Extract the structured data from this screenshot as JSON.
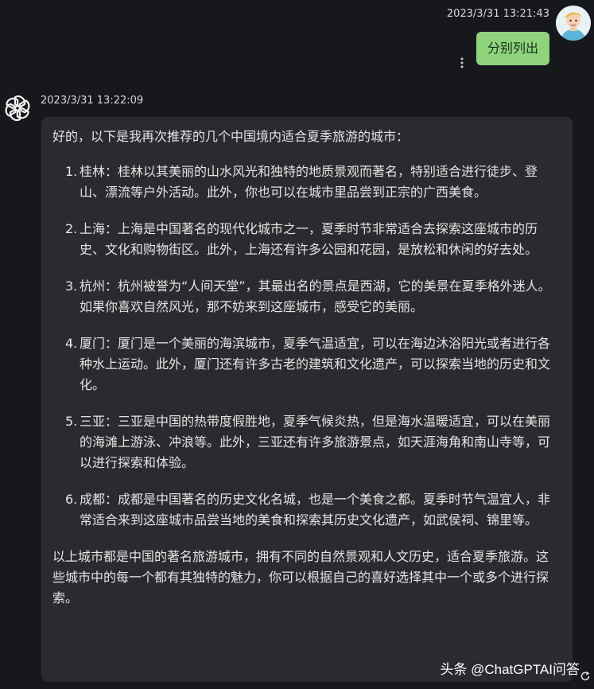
{
  "user_message": {
    "timestamp": "2023/3/31 13:21:43",
    "text": "分别列出",
    "avatar_icon": "user-avatar-icon",
    "more_icon": "more-vertical-icon"
  },
  "bot_message": {
    "timestamp": "2023/3/31 13:22:09",
    "avatar_icon": "openai-logo-icon",
    "intro": "好的，以下是我再次推荐的几个中国境内适合夏季旅游的城市：",
    "items": [
      {
        "num": "1.",
        "text": "桂林：桂林以其美丽的山水风光和独特的地质景观而著名，特别适合进行徒步、登山、漂流等户外活动。此外，你也可以在城市里品尝到正宗的广西美食。"
      },
      {
        "num": "2.",
        "text": "上海：上海是中国著名的现代化城市之一，夏季时节非常适合去探索这座城市的历史、文化和购物街区。此外，上海还有许多公园和花园，是放松和休闲的好去处。"
      },
      {
        "num": "3.",
        "text": "杭州：杭州被誉为“人间天堂”，其最出名的景点是西湖，它的美景在夏季格外迷人。如果你喜欢自然风光，那不妨来到这座城市，感受它的美丽。"
      },
      {
        "num": "4.",
        "text": "厦门：厦门是一个美丽的海滨城市，夏季气温适宜，可以在海边沐浴阳光或者进行各种水上运动。此外，厦门还有许多古老的建筑和文化遗产，可以探索当地的历史和文化。"
      },
      {
        "num": "5.",
        "text": "三亚：三亚是中国的热带度假胜地，夏季气候炎热，但是海水温暖适宜，可以在美丽的海滩上游泳、冲浪等。此外，三亚还有许多旅游景点，如天涯海角和南山寺等，可以进行探索和体验。"
      },
      {
        "num": "6.",
        "text": "成都：成都是中国著名的历史文化名城，也是一个美食之都。夏季时节气温宜人，非常适合来到这座城市品尝当地的美食和探索其历史文化遗产，如武侯祠、锦里等。"
      }
    ],
    "outro": "以上城市都是中国的著名旅游城市，拥有不同的自然景观和人文历史，适合夏季旅游。这些城市中的每一个都有其独特的魅力，你可以根据自己的喜好选择其中一个或多个进行探索。"
  },
  "watermark": "头条 @ChatGPTAI问答",
  "refresh_icon": "refresh-icon",
  "colors": {
    "background": "#17181c",
    "bot_bubble": "#2a2b2f",
    "user_bubble": "#8fd37c"
  }
}
